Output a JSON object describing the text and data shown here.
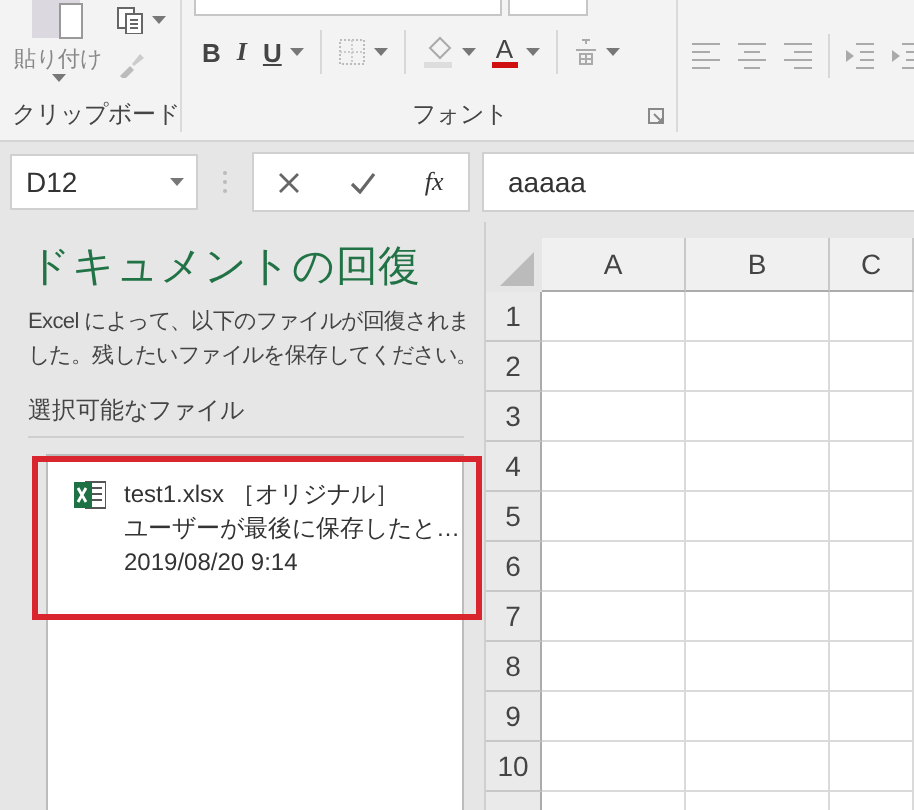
{
  "ribbon": {
    "clipboard_group": {
      "paste_label": "貼り付け",
      "label": "クリップボード"
    },
    "font_group": {
      "label": "フォント",
      "bold": "B",
      "italic": "I",
      "underline": "U",
      "font_color": "A"
    }
  },
  "formula_bar": {
    "name_box": "D12",
    "function_label": "fx",
    "formula": "aaaaa"
  },
  "recovery_pane": {
    "title": "ドキュメントの回復",
    "description": "Excel によって、以下のファイルが回復されました。残したいファイルを保存してください。",
    "list_label": "選択可能なファイル",
    "files": [
      {
        "name": "test1.xlsx ［オリジナル］",
        "status": "ユーザーが最後に保存したと…",
        "time": "2019/08/20 9:14",
        "selected": true
      }
    ]
  },
  "sheet": {
    "columns": [
      "A",
      "B",
      "C"
    ],
    "rows": [
      "1",
      "2",
      "3",
      "4",
      "5",
      "6",
      "7",
      "8",
      "9",
      "10"
    ]
  }
}
